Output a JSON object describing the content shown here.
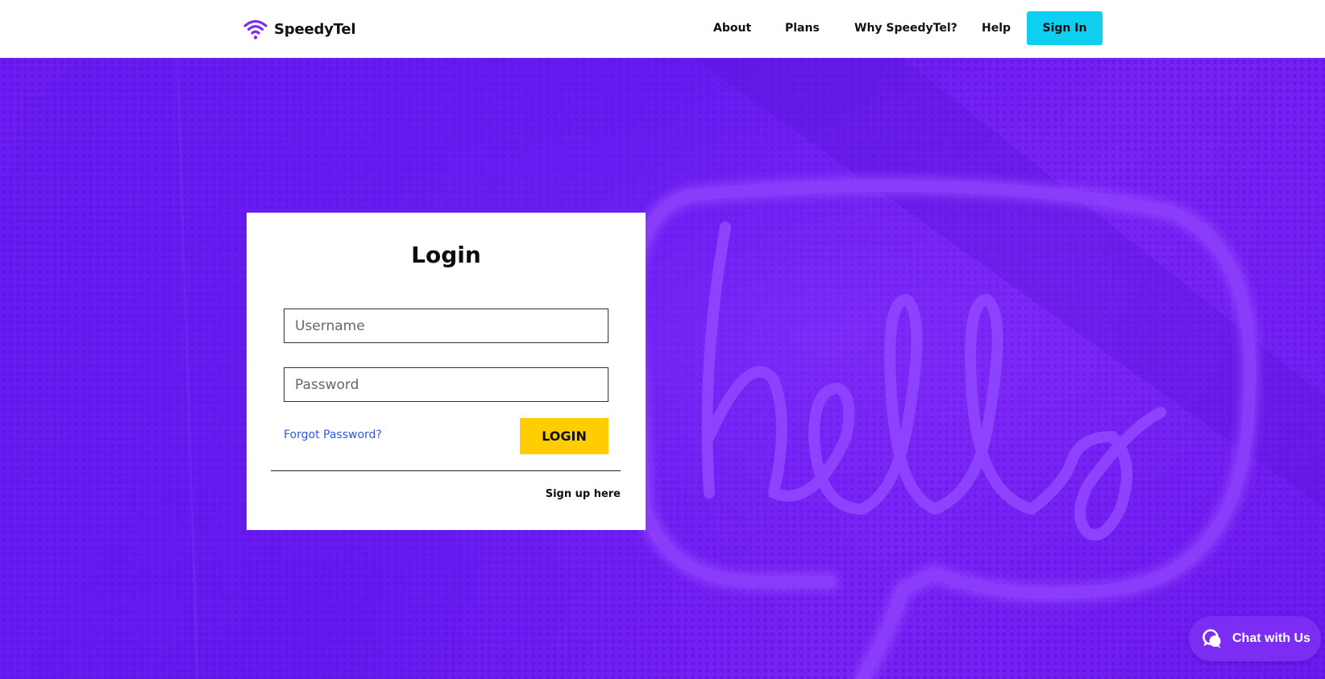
{
  "header": {
    "brand_name": "SpeedyTel",
    "brand_icon": "wifi-icon",
    "nav": {
      "about": "About",
      "plans": "Plans",
      "why": "Why SpeedyTel?",
      "help": "Help"
    },
    "signin_label": "Sign In"
  },
  "hero": {
    "background_image": "neon-hello-speech-bubble"
  },
  "login_card": {
    "title": "Login",
    "username_placeholder": "Username",
    "username_value": "",
    "password_placeholder": "Password",
    "password_value": "",
    "forgot_password": "Forgot Password?",
    "login_button": "LOGIN",
    "signup_link": "Sign up here"
  },
  "chat": {
    "label": "Chat with Us",
    "icon": "chat-bubbles-icon"
  },
  "colors": {
    "brand_purple": "#6a1cf2",
    "signin_cyan": "#0fcff0",
    "login_yellow": "#ffcd00",
    "link_blue": "#2f55e6",
    "chat_purple": "#7b2df4"
  }
}
